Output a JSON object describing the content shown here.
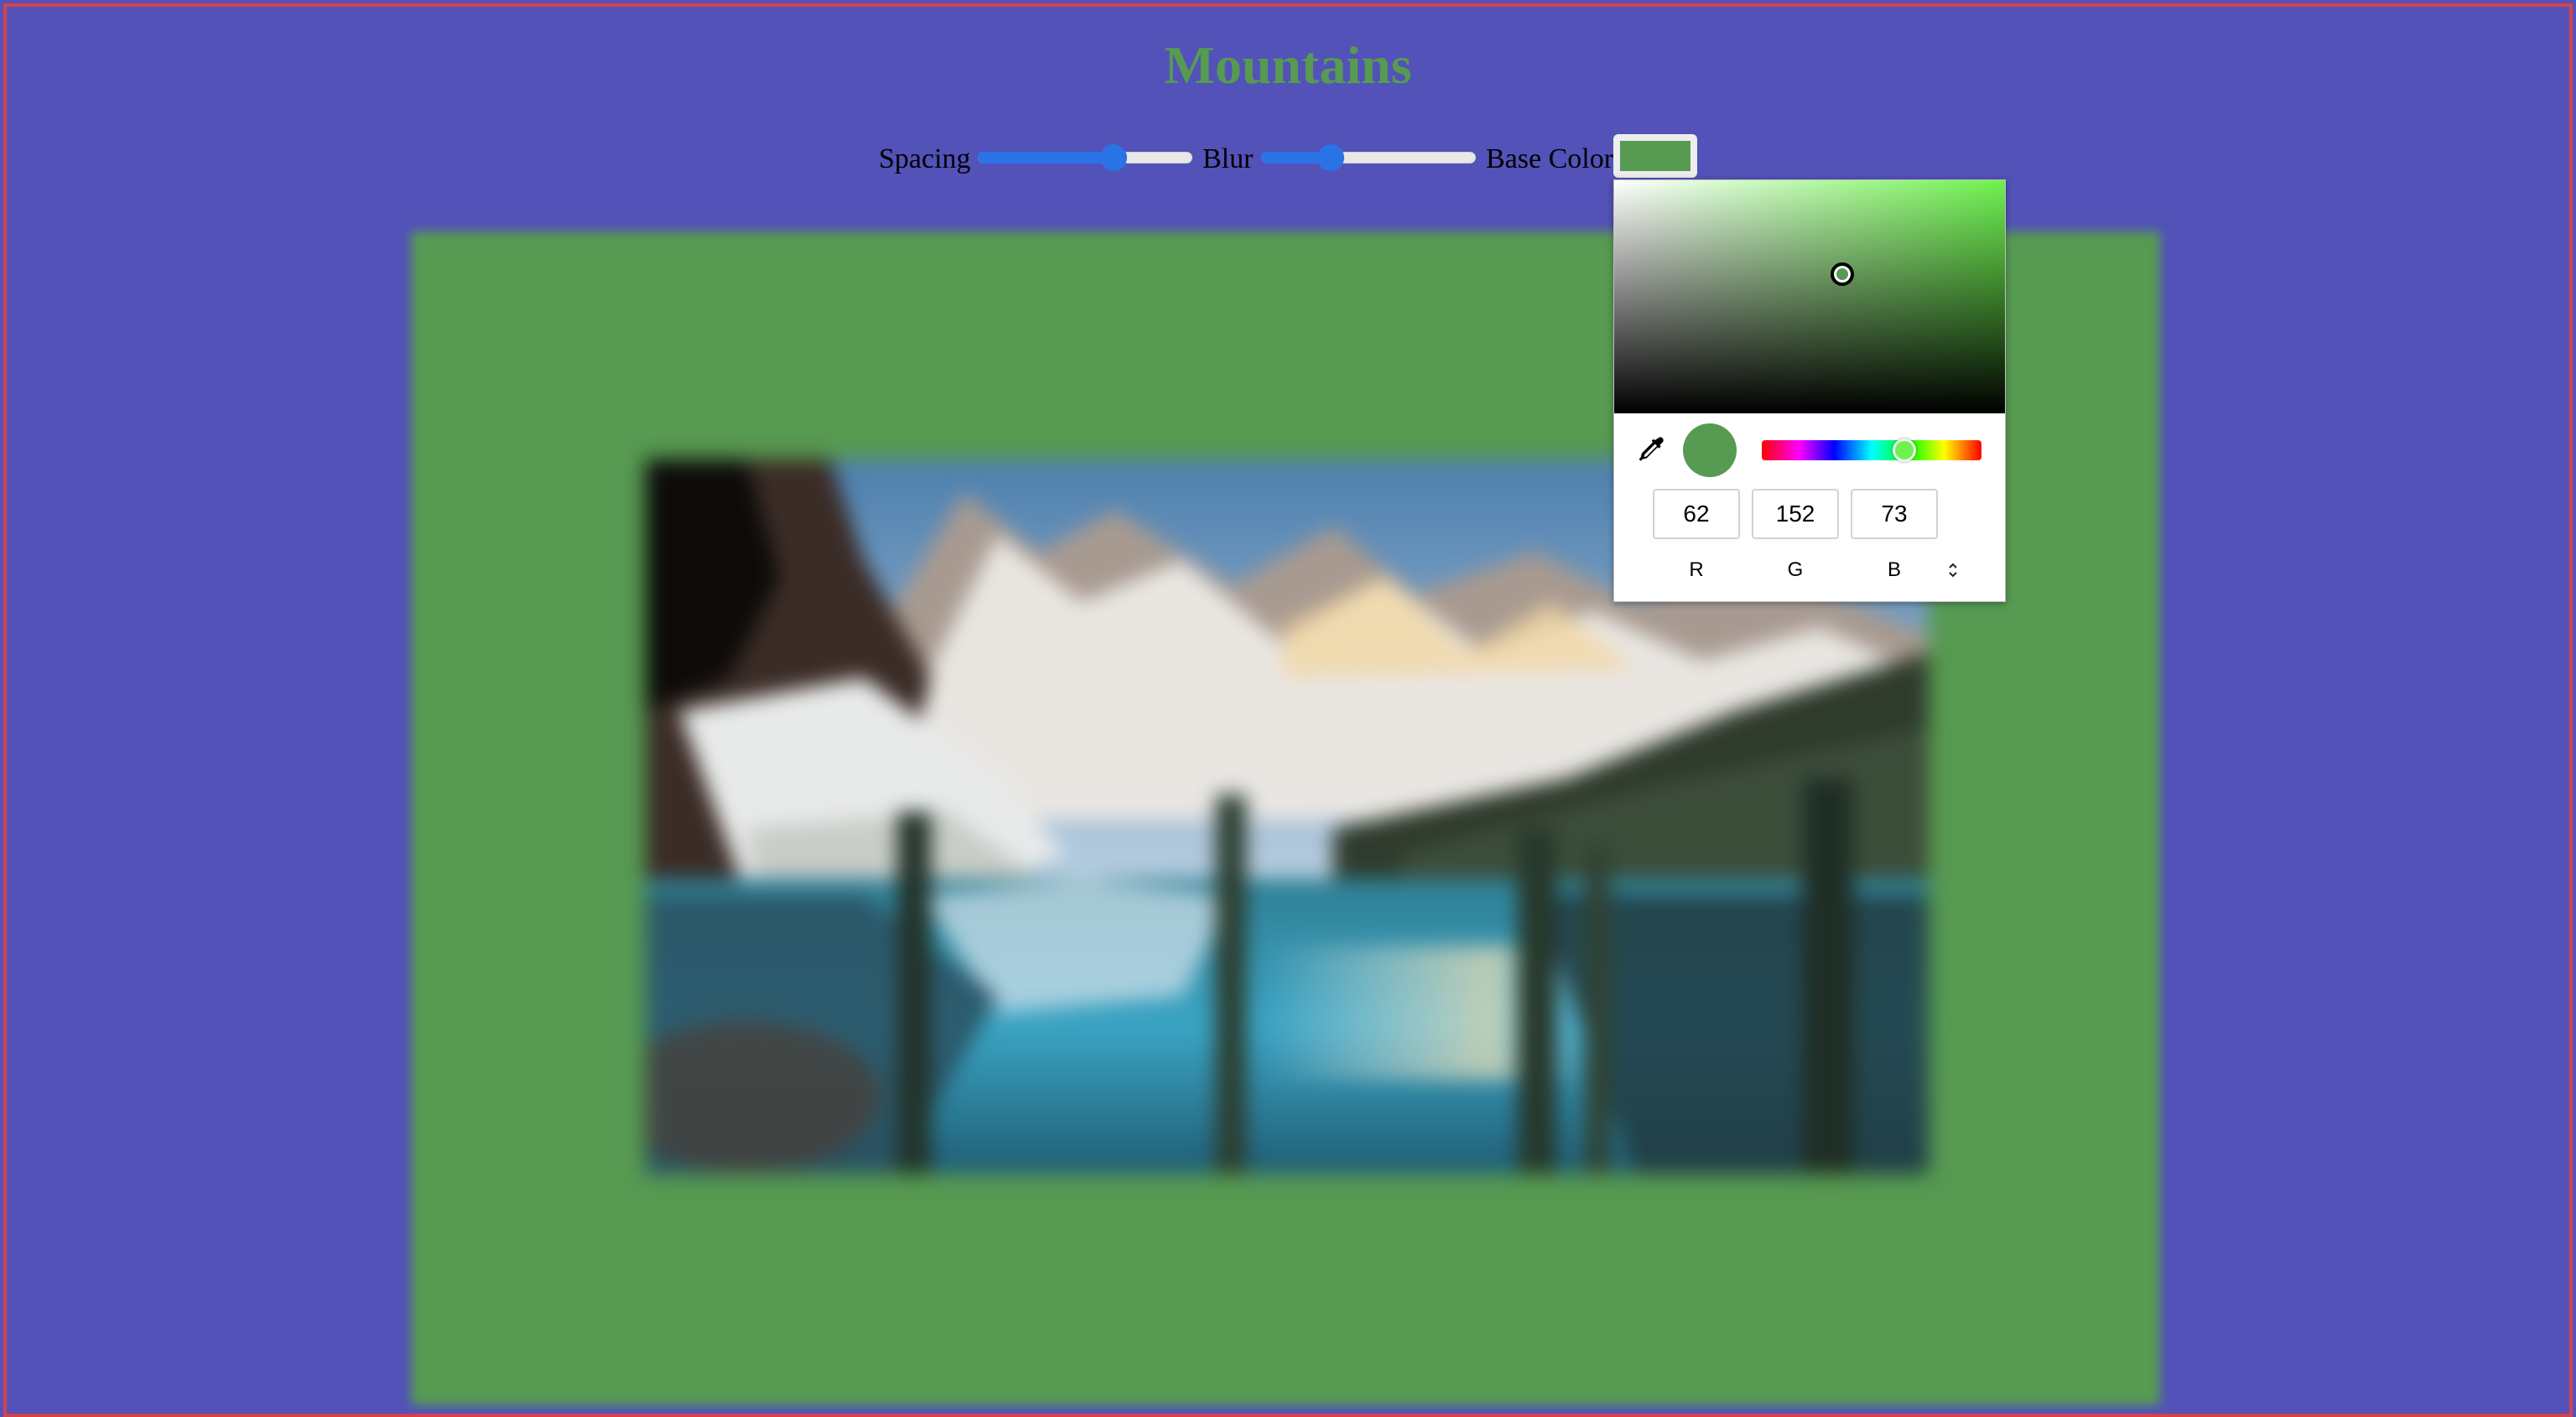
{
  "page": {
    "title": "Mountains"
  },
  "controls": {
    "spacing_label": "Spacing",
    "spacing_value": 0.65,
    "blur_label": "Blur",
    "blur_value": 0.3,
    "base_color_label": "Base Color",
    "base_color": "#579a52"
  },
  "colors": {
    "background": "#5252b8",
    "frame_border": "#d8404c",
    "accent": "#2a73e6",
    "base": "#579a52",
    "hue": "#6ef24e"
  },
  "image": {
    "subject": "blurred mountain lake photo"
  },
  "picker": {
    "r": "62",
    "g": "152",
    "b": "73",
    "r_label": "R",
    "g_label": "G",
    "b_label": "B",
    "hue_position": 0.65,
    "eyedropper_icon": "eyedropper-icon",
    "mode_toggle_icon": "up-down-chevron-icon"
  }
}
